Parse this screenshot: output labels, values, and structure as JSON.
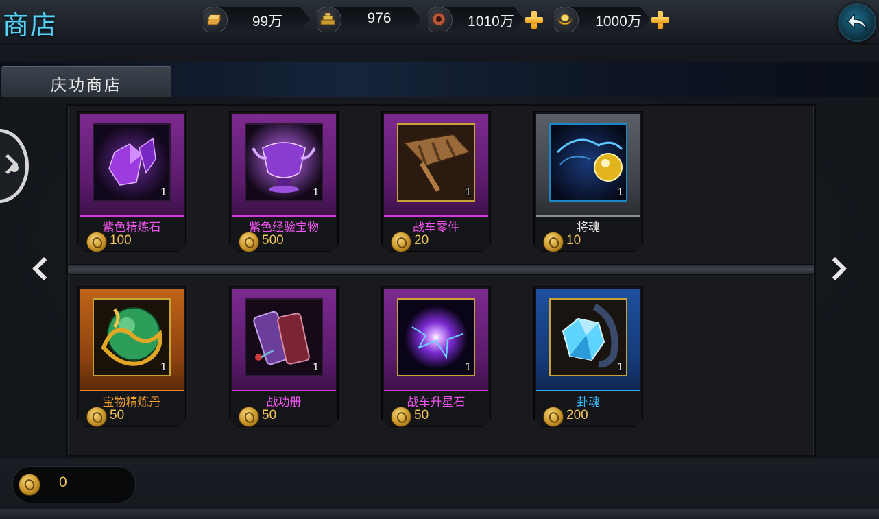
{
  "header": {
    "title": "商店",
    "currencies": [
      {
        "icon": "gold-bar-icon",
        "value": "99万",
        "has_plus": false
      },
      {
        "icon": "gold-ingot-stack-icon",
        "value": "976",
        "has_plus": false
      },
      {
        "icon": "bronze-coin-icon",
        "value": "1010万",
        "has_plus": true
      },
      {
        "icon": "gold-yuanbao-icon",
        "value": "1000万",
        "has_plus": true
      }
    ],
    "back_icon": "back-arrow-icon"
  },
  "tabs": [
    {
      "label": "庆功商店",
      "active": true
    }
  ],
  "items": [
    {
      "name": "紫色精炼石",
      "qty": "1",
      "price": "100",
      "rarity": "purple",
      "icon": "purple-crystal-icon"
    },
    {
      "name": "紫色经验宝物",
      "qty": "1",
      "price": "500",
      "rarity": "purple",
      "icon": "purple-chalice-icon"
    },
    {
      "name": "战车零件",
      "qty": "1",
      "price": "20",
      "rarity": "purple",
      "icon": "chariot-part-icon"
    },
    {
      "name": "将魂",
      "qty": "1",
      "price": "10",
      "rarity": "grey",
      "icon": "general-soul-icon"
    },
    {
      "name": "宝物精炼丹",
      "qty": "1",
      "price": "50",
      "rarity": "orange",
      "icon": "dragon-orb-icon"
    },
    {
      "name": "战功册",
      "qty": "1",
      "price": "50",
      "rarity": "purple",
      "icon": "merit-book-icon"
    },
    {
      "name": "战车升星石",
      "qty": "1",
      "price": "50",
      "rarity": "purple",
      "icon": "energy-orb-icon"
    },
    {
      "name": "卦魂",
      "qty": "1",
      "price": "200",
      "rarity": "blue",
      "icon": "blue-crystal-icon"
    }
  ],
  "footer": {
    "balance": "0",
    "balance_icon": "merit-coin-icon"
  },
  "colors": {
    "title": "#5ad2f5",
    "price": "#f1c35a",
    "purple_name": "#ee55ee",
    "orange_name": "#f2a02e",
    "blue_name": "#3ab3f3",
    "grey_name": "#e6e6e6"
  }
}
